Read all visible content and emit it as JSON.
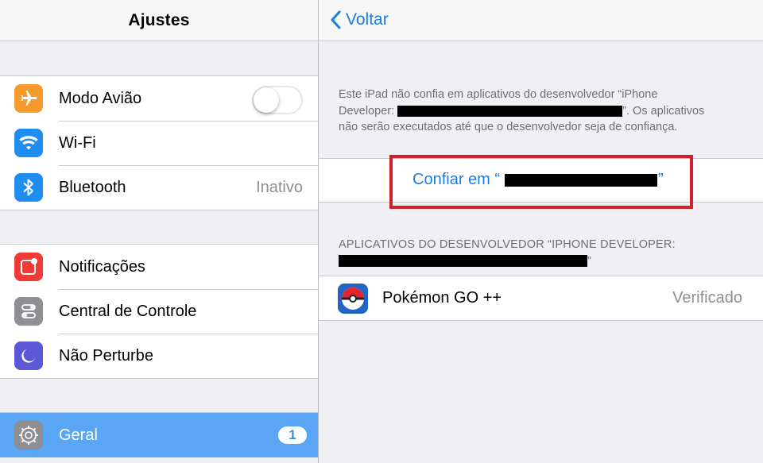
{
  "left": {
    "title": "Ajustes",
    "group1": [
      {
        "label": "Modo Avião",
        "icon": "airplane-icon",
        "color": "#f69a2c",
        "toggle": false
      },
      {
        "label": "Wi-Fi",
        "icon": "wifi-icon",
        "color": "#1e8cf0"
      },
      {
        "label": "Bluetooth",
        "icon": "bluetooth-icon",
        "color": "#1e8cf0",
        "value": "Inativo"
      }
    ],
    "group2": [
      {
        "label": "Notificações",
        "icon": "notifications-icon",
        "color": "#f03a36"
      },
      {
        "label": "Central de Controle",
        "icon": "control-center-icon",
        "color": "#8e8e93"
      },
      {
        "label": "Não Perturbe",
        "icon": "moon-icon",
        "color": "#5b57d6"
      }
    ],
    "group3": [
      {
        "label": "Geral",
        "icon": "gear-icon",
        "color": "#8e8e93",
        "badge": "1",
        "selected": true
      }
    ]
  },
  "right": {
    "back_label": "Voltar",
    "info_text_1": "Este iPad não confia em aplicativos do desenvolvedor “iPhone",
    "info_text_2_prefix": "Developer:",
    "info_text_2_suffix": "”. Os aplicativos",
    "info_text_3": "não serão executados até que o desenvolvedor seja de confiança.",
    "trust_prefix": "Confiar em “",
    "trust_suffix": "”",
    "section_header_1": "APLICATIVOS DO DESENVOLVEDOR “IPHONE DEVELOPER:",
    "section_header_2_suffix": "”",
    "app": {
      "name": "Pokémon GO ++",
      "status": "Verificado",
      "icon": "pokeball-icon"
    }
  },
  "colors": {
    "accent": "#1a7fe0",
    "selected_row": "#5aa6f4",
    "highlight_border": "#d0202a"
  }
}
